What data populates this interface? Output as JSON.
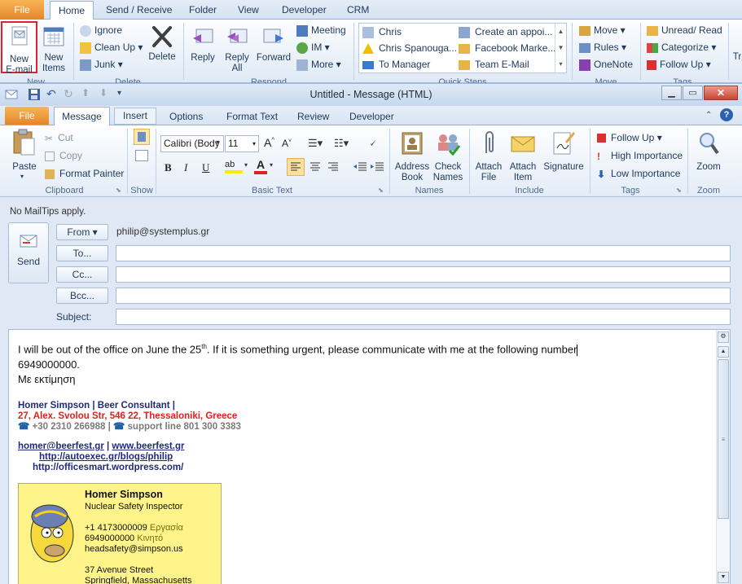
{
  "back": {
    "tabs": [
      "File",
      "Home",
      "Send / Receive",
      "Folder",
      "View",
      "Developer",
      "CRM"
    ],
    "new_email": "New\nE-mail",
    "new_items": "New\nItems",
    "new_group": "New",
    "ignore": "Ignore",
    "clean_up": "Clean Up",
    "junk": "Junk",
    "delete": "Delete",
    "delete_group": "Delete",
    "reply": "Reply",
    "reply_all": "Reply\nAll",
    "forward": "Forward",
    "meeting": "Meeting",
    "im": "IM",
    "more": "More",
    "respond_group": "Respond",
    "quick_steps": [
      "Chris",
      "Chris Spanouga...",
      "To Manager",
      "Create an appoi...",
      "Facebook Marke...",
      "Team E-Mail"
    ],
    "quick_group": "Quick Steps",
    "move": "Move",
    "rules": "Rules",
    "onenote": "OneNote",
    "move_group": "Move",
    "unread_read": "Unread/ Read",
    "categorize": "Categorize",
    "follow_up": "Follow Up",
    "tags_group": "Tags",
    "find_partial": "Tr"
  },
  "compose": {
    "title": "Untitled  -  Message (HTML)",
    "tabs": [
      "File",
      "Message",
      "Insert",
      "Options",
      "Format Text",
      "Review",
      "Developer"
    ],
    "paste": "Paste",
    "cut": "Cut",
    "copy": "Copy",
    "format_painter": "Format Painter",
    "clipboard_group": "Clipboard",
    "show_group": "Show",
    "font_name": "Calibri (Body",
    "font_size": "11",
    "basic_text_group": "Basic Text",
    "address_book": "Address\nBook",
    "check_names": "Check\nNames",
    "names_group": "Names",
    "attach_file": "Attach\nFile",
    "attach_item": "Attach\nItem",
    "signature": "Signature",
    "include_group": "Include",
    "follow_up": "Follow Up",
    "high_importance": "High Importance",
    "low_importance": "Low Importance",
    "tags_group": "Tags",
    "zoom": "Zoom",
    "zoom_group": "Zoom",
    "mailtips": "No MailTips apply.",
    "send": "Send",
    "from_label": "From",
    "from_value": "philip@systemplus.gr",
    "to_label": "To...",
    "cc_label": "Cc...",
    "bcc_label": "Bcc...",
    "subject_label": "Subject:",
    "to_value": "",
    "cc_value": "",
    "bcc_value": "",
    "subject_value": ""
  },
  "message": {
    "line1_pre": "I will be out of the office on June the 25",
    "line1_sup": "th",
    "line1_post": ".  If it is something urgent, please communicate with me at the following number",
    "line2": "6949000000.",
    "line3": "Με εκτίμηση"
  },
  "signature": {
    "name_line": "Homer Simpson | Beer Consultant |",
    "address": "27, Alex. Svolou Str, 546 22, Thessaloniki, Greece",
    "phone": "+30 2310 266988",
    "support": "support line 801 300 3383",
    "email": "homer@beerfest.gr",
    "site": "www.beerfest.gr",
    "blog": "http://autoexec.gr/blogs/philip",
    "blog2": "http://officesmart.wordpress.com/"
  },
  "card": {
    "name": "Homer Simpson",
    "role": "Nuclear Safety Inspector",
    "work_phone": "+1 4173000009",
    "work_label": "Εργασία",
    "mobile": "6949000000",
    "mobile_label": "Κινητό",
    "email": "headsafety@simpson.us",
    "street": "37 Avenue Street",
    "city": "Springfield, Massachusetts"
  },
  "colors": {
    "file_tab": "#e4852a",
    "sig_navy": "#1f2a7a",
    "sig_red": "#e02020",
    "sig_gray": "#7a7a7a",
    "card_bg": "#fff48a"
  }
}
